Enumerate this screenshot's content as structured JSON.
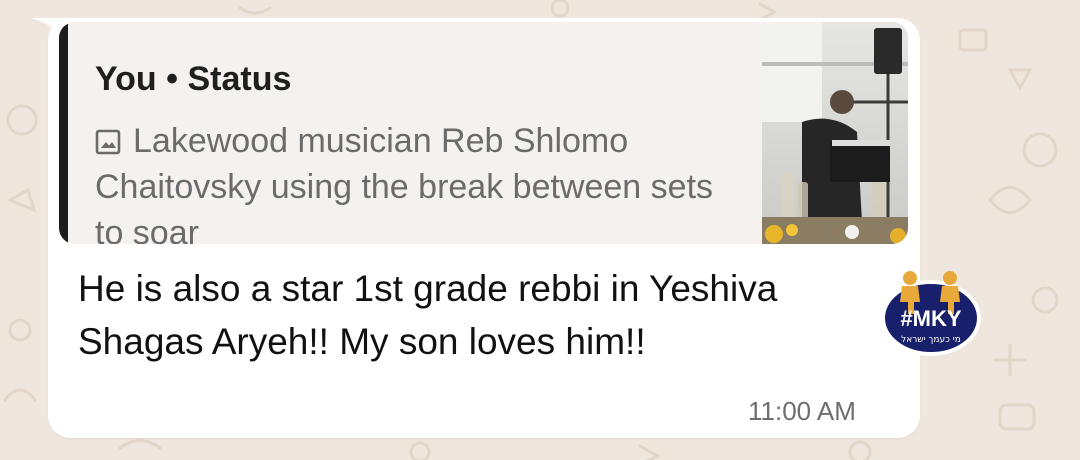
{
  "quoted_status": {
    "title": "You • Status",
    "media_icon": "image-icon",
    "caption": "Lakewood musician Reb Shlomo Chaitovsky using the break between sets to soar"
  },
  "message": {
    "text": "He is also a star 1st grade rebbi in Yeshiva Shagas Aryeh!! My son loves him!!",
    "time": "11:00 AM"
  },
  "badge": {
    "tag": "#MKY",
    "subtitle": "מי כעמך ישראל"
  },
  "colors": {
    "wallpaper": "#efe7dd",
    "bubble": "#ffffff",
    "quote_bg": "#f4f1ee",
    "quote_bar": "#1d1d1d",
    "badge_bg": "#18206b"
  }
}
